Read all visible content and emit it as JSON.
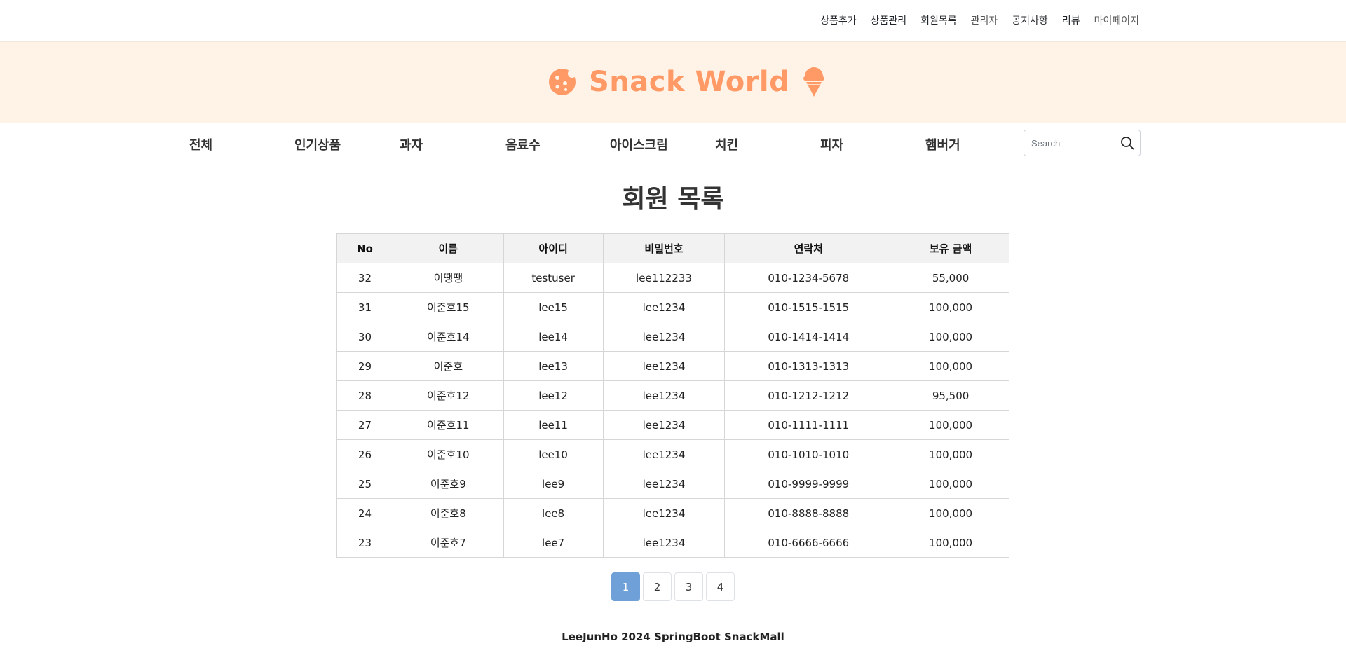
{
  "top_links": [
    {
      "label": "상품추가"
    },
    {
      "label": "상품관리"
    },
    {
      "label": "회원목록"
    },
    {
      "label": "관리자"
    },
    {
      "label": "공지사항"
    },
    {
      "label": "리뷰"
    },
    {
      "label": "마이페이지"
    }
  ],
  "brand": {
    "title": "Snack World",
    "left_icon": "cookie-icon",
    "right_icon": "ice-cream-icon",
    "color": "#ff9966"
  },
  "nav": {
    "items": [
      {
        "label": "전체"
      },
      {
        "label": "인기상품"
      },
      {
        "label": "과자"
      },
      {
        "label": "음료수"
      },
      {
        "label": "아이스크림"
      },
      {
        "label": "치킨"
      },
      {
        "label": "피자"
      },
      {
        "label": "햄버거"
      }
    ],
    "search": {
      "placeholder": "Search",
      "value": "",
      "icon": "search-icon"
    }
  },
  "page": {
    "title": "회원 목록"
  },
  "members_table": {
    "columns": [
      "No",
      "이름",
      "아이디",
      "비밀번호",
      "연락처",
      "보유 금액"
    ],
    "rows": [
      [
        "32",
        "이땡땡",
        "testuser",
        "lee112233",
        "010-1234-5678",
        "55,000"
      ],
      [
        "31",
        "이준호15",
        "lee15",
        "lee1234",
        "010-1515-1515",
        "100,000"
      ],
      [
        "30",
        "이준호14",
        "lee14",
        "lee1234",
        "010-1414-1414",
        "100,000"
      ],
      [
        "29",
        "이준호",
        "lee13",
        "lee1234",
        "010-1313-1313",
        "100,000"
      ],
      [
        "28",
        "이준호12",
        "lee12",
        "lee1234",
        "010-1212-1212",
        "95,500"
      ],
      [
        "27",
        "이준호11",
        "lee11",
        "lee1234",
        "010-1111-1111",
        "100,000"
      ],
      [
        "26",
        "이준호10",
        "lee10",
        "lee1234",
        "010-1010-1010",
        "100,000"
      ],
      [
        "25",
        "이준호9",
        "lee9",
        "lee1234",
        "010-9999-9999",
        "100,000"
      ],
      [
        "24",
        "이준호8",
        "lee8",
        "lee1234",
        "010-8888-8888",
        "100,000"
      ],
      [
        "23",
        "이준호7",
        "lee7",
        "lee1234",
        "010-6666-6666",
        "100,000"
      ]
    ]
  },
  "pagination": {
    "pages": [
      "1",
      "2",
      "3",
      "4"
    ],
    "active": "1",
    "active_color": "#6fa1d8"
  },
  "footer": {
    "text": "LeeJunHo 2024 SpringBoot SnackMall"
  }
}
